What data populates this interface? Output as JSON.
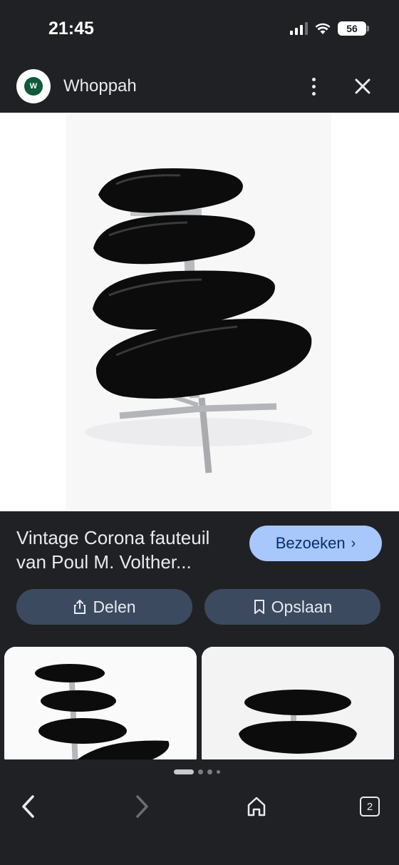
{
  "status_bar": {
    "time": "21:45",
    "battery": "56"
  },
  "header": {
    "favicon_letter": "W",
    "site_name": "Whoppah"
  },
  "result": {
    "title": "Vintage Corona fauteuil van Poul M. Volther...",
    "visit_label": "Bezoeken",
    "share_label": "Delen",
    "save_label": "Opslaan"
  },
  "pager": {
    "total": 4,
    "active_index": 0
  },
  "bottom_nav": {
    "tab_count": "2"
  },
  "colors": {
    "accent": "#a8c7fa",
    "pill_bg": "#3c4a60",
    "background": "#202124"
  }
}
